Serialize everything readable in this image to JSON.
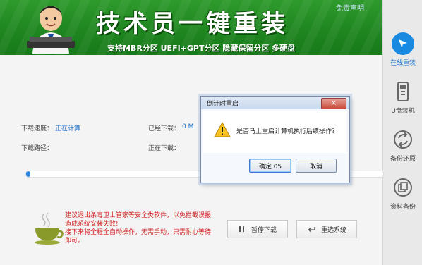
{
  "banner": {
    "title": "技术员一键重装",
    "subtitle": "支持MBR分区 UEFI+GPT分区 隐藏保留分区 多硬盘",
    "disclaimer": "免责声明"
  },
  "sidebar": {
    "items": [
      {
        "label": "在线重装",
        "icon": "cursor-icon",
        "active": true
      },
      {
        "label": "U盘装机",
        "icon": "usb-icon",
        "active": false
      },
      {
        "label": "备份还原",
        "icon": "sync-icon",
        "active": false
      },
      {
        "label": "资料备份",
        "icon": "copy-icon",
        "active": false
      }
    ]
  },
  "status": {
    "speed_label": "下载速度：",
    "speed_value": "正在计算",
    "downloaded_label": "已经下载：",
    "downloaded_value": "0 M",
    "path_label": "下载路径：",
    "downloading_label": "正在下载："
  },
  "progress": {
    "fraction": 0.01
  },
  "warning": {
    "line1": "建议退出杀毒卫士管家等安全类软件，以免拦截误报造成系统安装失败!",
    "line2": "接下来将全程全自动操作，无需手动，只需耐心等待即可。"
  },
  "buttons": {
    "pause": "暂停下载",
    "reselect": "重选系统"
  },
  "dialog": {
    "title": "倒计时重启",
    "close": "×",
    "message": "是否马上重启计算机执行后续操作？",
    "ok": "确定 05",
    "cancel": "取消"
  },
  "colors": {
    "banner_green": "#1f8620",
    "accent_blue": "#1a8ae0",
    "warning_red": "#d02020"
  }
}
